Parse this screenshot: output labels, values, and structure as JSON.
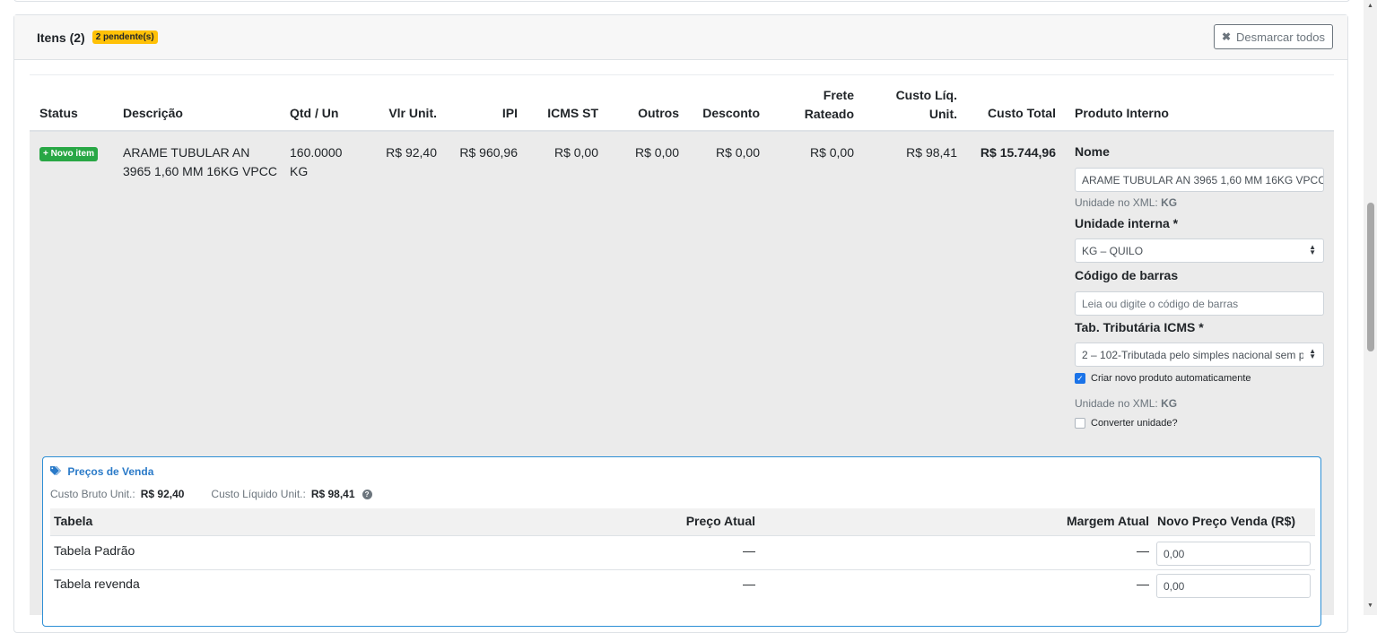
{
  "header": {
    "title": "Itens (2)",
    "pending_badge": "2 pendente(s)",
    "unmark_all_label": "Desmarcar todos"
  },
  "columns": [
    "Status",
    "Descrição",
    "Qtd / Un",
    "Vlr Unit.",
    "IPI",
    "ICMS ST",
    "Outros",
    "Desconto",
    "Frete Rateado",
    "Custo Líq. Unit.",
    "Custo Total",
    "Produto Interno"
  ],
  "columns_split": {
    "frete_1": "Frete",
    "frete_2": "Rateado",
    "custo_liq_1": "Custo Líq.",
    "custo_liq_2": "Unit."
  },
  "item": {
    "status_badge": "+ Novo item",
    "description_line1": "ARAME TUBULAR AN",
    "description_line2": "3965 1,60 MM 16KG VPCC",
    "qty": "160.0000",
    "unit": "KG",
    "vlr_unit": "R$ 92,40",
    "ipi": "R$ 960,96",
    "icms_st": "R$ 0,00",
    "outros": "R$ 0,00",
    "desconto": "R$ 0,00",
    "frete_rateado": "R$ 0,00",
    "custo_liq_unit": "R$ 98,41",
    "custo_total": "R$ 15.744,96"
  },
  "produto_interno": {
    "nome_label": "Nome",
    "nome_value": "ARAME TUBULAR AN 3965 1,60 MM 16KG VPCC",
    "unidade_xml_label": "Unidade no XML:",
    "unidade_xml_value": "KG",
    "unidade_interna_label": "Unidade interna *",
    "unidade_interna_value": "KG – QUILO",
    "codigo_barras_label": "Código de barras",
    "codigo_barras_placeholder": "Leia ou digite o código de barras",
    "tab_tributaria_label": "Tab. Tributária ICMS *",
    "tab_tributaria_value": "2 – 102-Tributada pelo simples nacional sem p",
    "criar_novo_label": "Criar novo produto automaticamente",
    "criar_novo_checked": true,
    "unidade_xml_label_2": "Unidade no XML:",
    "unidade_xml_value_2": "KG",
    "converter_label": "Converter unidade?",
    "converter_checked": false
  },
  "precos": {
    "title": "Preços de Venda",
    "custo_bruto_label": "Custo Bruto Unit.:",
    "custo_bruto_value": "R$ 92,40",
    "custo_liquido_label": "Custo Líquido Unit.:",
    "custo_liquido_value": "R$ 98,41",
    "headers": {
      "tabela": "Tabela",
      "preco_atual": "Preço Atual",
      "margem_atual": "Margem Atual",
      "novo_preco": "Novo Preço Venda (R$)"
    },
    "rows": [
      {
        "tabela": "Tabela Padrão",
        "preco_atual": "—",
        "margem_atual": "—",
        "novo_preco": "0,00"
      },
      {
        "tabela": "Tabela revenda",
        "preco_atual": "—",
        "margem_atual": "—",
        "novo_preco": "0,00"
      }
    ]
  },
  "colors": {
    "badge_warning": "#ffc107",
    "badge_success": "#28a745",
    "accent_blue": "#2a7ac8",
    "row_background": "#ebebeb"
  },
  "icons": [
    "times-icon",
    "tags-icon",
    "question-circle-icon",
    "select-arrows-icon",
    "check-icon"
  ]
}
